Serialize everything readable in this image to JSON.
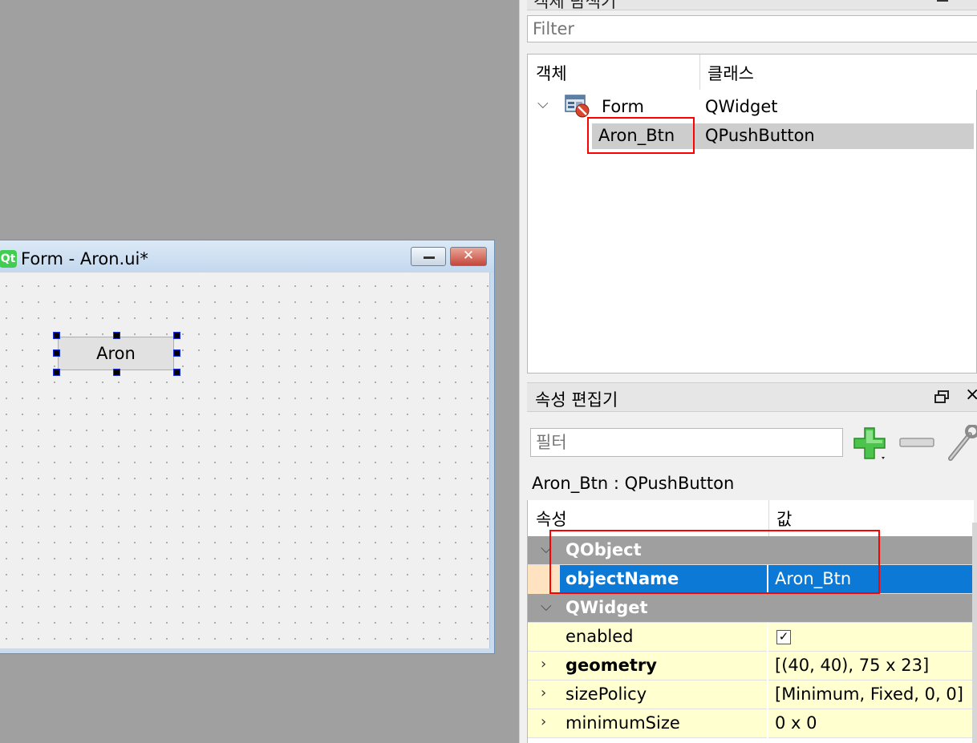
{
  "object_inspector": {
    "title": "객체 탐색기",
    "filter_placeholder": "Filter",
    "columns": {
      "object": "객체",
      "class": "클래스"
    },
    "rows": [
      {
        "name": "Form",
        "class": "QWidget",
        "expanded": true
      },
      {
        "name": "Aron_Btn",
        "class": "QPushButton",
        "selected": true
      }
    ]
  },
  "form_window": {
    "title": "Form - Aron.ui*",
    "logo": "Qt",
    "close_glyph": "✕",
    "button_text": "Aron"
  },
  "property_editor": {
    "title": "속성 편집기",
    "filter_placeholder": "필터",
    "subject": "Aron_Btn : QPushButton",
    "columns": {
      "property": "속성",
      "value": "값"
    },
    "rows": [
      {
        "type": "section",
        "name": "QObject"
      },
      {
        "type": "property",
        "name": "objectName",
        "value": "Aron_Btn",
        "selected": true
      },
      {
        "type": "section",
        "name": "QWidget"
      },
      {
        "type": "property",
        "name": "enabled",
        "value": "",
        "checked": true
      },
      {
        "type": "property",
        "name": "geometry",
        "value": "[(40, 40), 75 x 23]",
        "bold": true,
        "expandable": true
      },
      {
        "type": "property",
        "name": "sizePolicy",
        "value": "[Minimum, Fixed, 0, 0]",
        "expandable": true
      },
      {
        "type": "property",
        "name": "minimumSize",
        "value": "0 x 0",
        "expandable": true
      }
    ]
  },
  "colors": {
    "selection_blue": "#0c79d6",
    "highlight_red": "#ff0000",
    "section_gray": "#9f9f9f",
    "property_yellow": "#ffffd0",
    "qt_green": "#41cd52"
  }
}
